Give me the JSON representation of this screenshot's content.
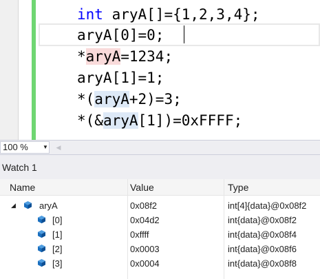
{
  "editor": {
    "lines": [
      {
        "kw": "int",
        "rest": " aryA[]={1,2,3,4};"
      },
      {
        "var": "aryA",
        "rest": "[0]=0;"
      },
      {
        "pre": "*",
        "var": "aryA",
        "rest": "=1234;"
      },
      {
        "var": "aryA",
        "rest": "[1]=1;"
      },
      {
        "pre": "*(",
        "var": "aryA",
        "rest": "+2)=3;"
      },
      {
        "pre": "*(&",
        "var": "aryA",
        "rest": "[1])=0xFFFF;"
      }
    ]
  },
  "zoom": {
    "value": "100 %",
    "arrow": "▼",
    "scroll_left": "◀"
  },
  "watch": {
    "title": "Watch 1",
    "columns": {
      "name": "Name",
      "value": "Value",
      "type": "Type"
    },
    "rows": [
      {
        "name": "aryA",
        "value": "0x08f2",
        "type": "int[4]{data}@0x08f2",
        "expander": "◢"
      },
      {
        "name": "[0]",
        "value": "0x04d2",
        "type": "int{data}@0x08f2"
      },
      {
        "name": "[1]",
        "value": "0xffff",
        "type": "int{data}@0x08f4"
      },
      {
        "name": "[2]",
        "value": "0x0003",
        "type": "int{data}@0x08f6"
      },
      {
        "name": "[3]",
        "value": "0x0004",
        "type": "int{data}@0x08f8"
      }
    ]
  },
  "colors": {
    "keyword": "#0000ff",
    "change_bar": "#6fd672",
    "highlight_read": "#f9dada",
    "highlight_write": "#dde9f7",
    "object_icon": "#1a6fbf"
  },
  "icons": {
    "variable": "cube-icon",
    "expander": "triangle-expanded-icon"
  }
}
